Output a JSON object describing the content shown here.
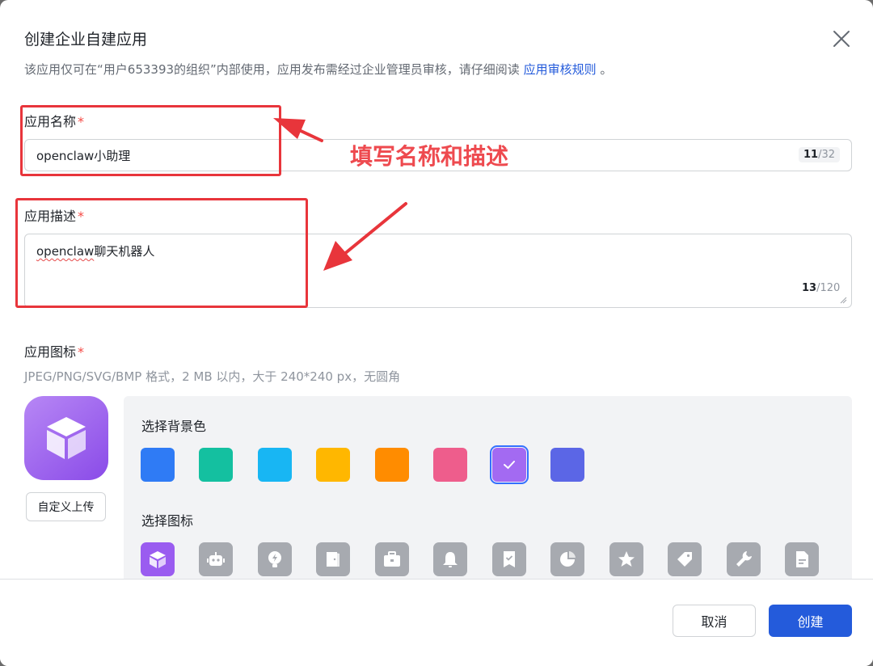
{
  "dialog": {
    "title": "创建企业自建应用",
    "subtitle_prefix": "该应用仅可在“用户653393的组织”内部使用，应用发布需经过企业管理员审核，请仔细阅读 ",
    "subtitle_link": "应用审核规则",
    "subtitle_suffix": " 。"
  },
  "name_field": {
    "label": "应用名称",
    "required_mark": "*",
    "value": "openclaw小助理",
    "count_current": "11",
    "count_max": "/32"
  },
  "desc_field": {
    "label": "应用描述",
    "required_mark": "*",
    "value_latin": "openclaw",
    "value_cjk": "聊天机器人",
    "count_current": "13",
    "count_max": "/120"
  },
  "icon_field": {
    "label": "应用图标",
    "required_mark": "*",
    "hint": "JPEG/PNG/SVG/BMP 格式，2 MB 以内，大于 240*240 px，无圆角",
    "upload_label": "自定义上传",
    "bg_label": "选择背景色",
    "icon_label": "选择图标",
    "bg_colors": [
      "#2f7bf5",
      "#14c0a0",
      "#18b6f3",
      "#ffb700",
      "#ff8c00",
      "#ee5d8c",
      "#a36af2",
      "#5b66e6"
    ],
    "selected_bg_index": 6,
    "icons": [
      "cube-icon",
      "robot-icon",
      "bulb-icon",
      "door-icon",
      "briefcase-icon",
      "bell-icon",
      "bookmark-check-icon",
      "pie-icon",
      "star-icon",
      "tag-icon",
      "wrench-icon",
      "document-icon"
    ],
    "selected_icon_index": 0
  },
  "footer": {
    "cancel_label": "取消",
    "create_label": "创建",
    "primary_color": "#245bdb"
  },
  "annotation": {
    "text": "填写名称和描述",
    "color": "#e8353b"
  }
}
